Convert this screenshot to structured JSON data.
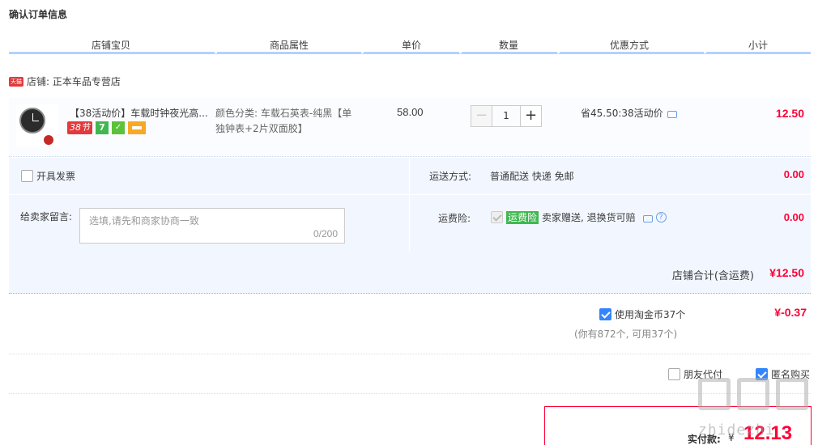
{
  "page_title": "确认订单信息",
  "columns": [
    "店铺宝贝",
    "商品属性",
    "单价",
    "数量",
    "优惠方式",
    "小计"
  ],
  "shop": {
    "badge": "天猫",
    "label": "店铺: 正本车品专营店"
  },
  "item": {
    "title": "【38活动价】车载时钟夜光高...",
    "badges": {
      "festival": "38节",
      "seven": "7"
    },
    "attributes": "颜色分类: 车载石英表-纯黑【单独钟表+2片双面胶】",
    "price": "58.00",
    "quantity": "1",
    "qty_minus": "−",
    "qty_plus": "+",
    "discount": "省45.50:38活动价",
    "subtotal": "12.50"
  },
  "invoice": {
    "label": "开具发票",
    "checked": false
  },
  "message": {
    "label": "给卖家留言:",
    "placeholder": "选填,请先和商家协商一致",
    "count": "0/200"
  },
  "shipping": {
    "label": "运送方式:",
    "value": "普通配送 快递 免邮",
    "cost": "0.00"
  },
  "insurance": {
    "label": "运费险:",
    "tag": "运费险",
    "desc": "卖家赠送, 退换货可赔",
    "help": "?",
    "cost": "0.00"
  },
  "shop_total": {
    "label": "店铺合计(含运费)",
    "value": "¥12.50"
  },
  "coins": {
    "label": "使用淘金币37个",
    "sub": "(你有872个, 可用37个)",
    "value": "¥-0.37",
    "checked": true
  },
  "friend_pay": {
    "label": "朋友代付",
    "checked": false
  },
  "anonymous": {
    "label": "匿名购买",
    "checked": true
  },
  "payment": {
    "label": "实付款:",
    "currency": "¥",
    "amount": "12.13"
  },
  "watermark": "zhidezhi",
  "colors": {
    "price_red": "#ff0036",
    "accent_blue": "#3385ff",
    "panel_bg": "#f2f7ff"
  }
}
